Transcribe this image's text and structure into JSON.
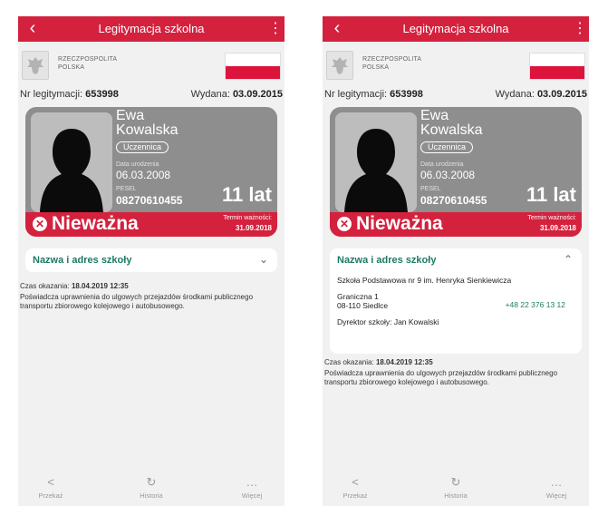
{
  "left": {
    "topbar": {
      "title": "Legitymacja szkolna"
    },
    "header": {
      "country_line1": "RZECZPOSPOLITA",
      "country_line2": "POLSKA"
    },
    "meta": {
      "nr_label": "Nr legitymacji:",
      "nr_value": "653998",
      "issued_label": "Wydana:",
      "issued_value": "03.09.2015"
    },
    "card": {
      "first_name": "Ewa",
      "last_name": "Kowalska",
      "role": "Uczennica",
      "dob_label": "Data urodzenia",
      "dob_value": "06.03.2008",
      "pesel_label": "PESEL",
      "pesel_value": "08270610455",
      "age": "11 lat",
      "status": "Nieważna",
      "valid_label": "Termin ważności:",
      "valid_value": "31.09.2018"
    },
    "school": {
      "label": "Nazwa i adres szkoły"
    },
    "shown": {
      "label": "Czas okazania:",
      "value": "18.04.2019 12:35"
    },
    "description": "Poświadcza uprawnienia do ulgowych przejazdów środkami publicznego transportu zbiorowego kolejowego i autobusowego."
  },
  "right": {
    "topbar": {
      "title": "Legitymacja szkolna"
    },
    "header": {
      "country_line1": "RZECZPOSPOLITA",
      "country_line2": "POLSKA"
    },
    "meta": {
      "nr_label": "Nr legitymacji:",
      "nr_value": "653998",
      "issued_label": "Wydana:",
      "issued_value": "03.09.2015"
    },
    "card": {
      "first_name": "Ewa",
      "last_name": "Kowalska",
      "role": "Uczennica",
      "dob_label": "Data urodzenia",
      "dob_value": "06.03.2008",
      "pesel_label": "PESEL",
      "pesel_value": "08270610455",
      "age": "11 lat",
      "status": "Nieważna",
      "valid_label": "Termin ważności:",
      "valid_value": "31.09.2018"
    },
    "school": {
      "label": "Nazwa i adres szkoły",
      "name": "Szkoła Podstawowa nr 9 im. Henryka Sienkiewicza",
      "street": "Graniczna 1",
      "city": "08-110 Siedlce",
      "phone": "+48 22 376 13 12",
      "director": "Dyrektor szkoły: Jan Kowalski"
    },
    "shown": {
      "label": "Czas okazania:",
      "value": "18.04.2019 12:35"
    },
    "description": "Poświadcza uprawnienia do ulgowych przejazdów środkami publicznego transportu zbiorowego kolejowego i autobusowego."
  },
  "nav": {
    "share": "Przekaż",
    "history": "Historia",
    "more": "Więcej"
  },
  "colors": {
    "accent": "#d4213d",
    "school_green": "#1e7a63",
    "card_gray": "#8e8e8e"
  },
  "icons": {
    "back": "chevron-left-icon",
    "menu": "more-vertical-icon",
    "share": "share-icon",
    "history": "history-icon",
    "more": "more-horizontal-icon"
  }
}
